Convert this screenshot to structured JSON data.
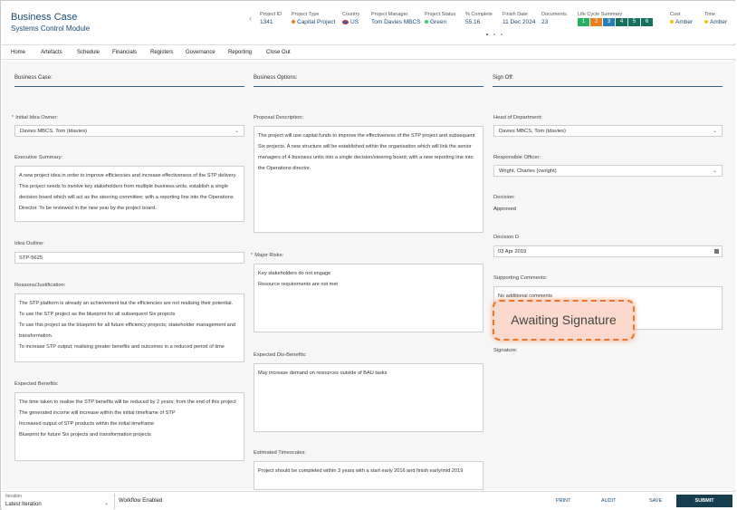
{
  "header": {
    "title": "Business Case",
    "subtitle": "Systems Control Module",
    "meta": [
      {
        "label": "Project ID",
        "value": "1341"
      },
      {
        "label": "Project Type",
        "value": "Capital Project",
        "dot_color": "#e67e22"
      },
      {
        "label": "Country",
        "value": "US"
      },
      {
        "label": "Project Manager",
        "value": "Tom Davies MBCS"
      },
      {
        "label": "Project Status",
        "value": "Green",
        "dot_color": "#2ecc71"
      },
      {
        "label": "% Complete",
        "value": "55.16"
      },
      {
        "label": "Finish Date",
        "value": "11 Dec 2024"
      },
      {
        "label": "Documents",
        "value": "23"
      },
      {
        "label": "Life Cycle Summary"
      },
      {
        "label": "Cost",
        "value": "Amber",
        "dot_color": "#f1c40f"
      },
      {
        "label": "Time",
        "value": "Amber",
        "dot_color": "#f1c40f"
      }
    ],
    "lifecycle": [
      {
        "n": "1",
        "color": "#27ae60"
      },
      {
        "n": "2",
        "color": "#e67e22"
      },
      {
        "n": "3",
        "color": "#2980b9"
      },
      {
        "n": "4",
        "color": "#16705f"
      },
      {
        "n": "5",
        "color": "#16705f"
      },
      {
        "n": "6",
        "color": "#16705f"
      }
    ]
  },
  "nav": [
    "Home",
    "Artefacts",
    "Schedule",
    "Financials",
    "Registers",
    "Governance",
    "Reporting",
    "Close Out"
  ],
  "sections": {
    "business_case": "Business Case:",
    "business_options": "Business Options:",
    "sign_off": "Sign Off:"
  },
  "left": {
    "idea_owner_label": "Initial Idea Owner:",
    "idea_owner_value": "Davies MBCS, Tom (tdavies)",
    "exec_summary_label": "Executive Summary:",
    "exec_summary": "A new project idea in order to improve efficiencies and increase effectiveness of the STP delivery. This project needs to involve key stakeholders from multiple business units. establish a single decision board which will act as the steering committee; with a reporting line into the Operations Director. To be reviewed in the new year by the project board.",
    "idea_outline_label": "Idea Outline:",
    "idea_outline_value": "STP-5625",
    "reasons_label": "Reasons/Justification:",
    "reasons": [
      "The STP platform is already an achievement but the efficiencies are not realising their potential.",
      "To use the STP project as the blueprint for all subsequent Six projects",
      "To use this project as the blueprint for all future efficiency projects; stakeholder management and transformation.",
      "To increase STP output; realising greater benefits and outcomes in a reduced period of time"
    ],
    "benefits_label": "Expected Benefits:",
    "benefits": [
      "The time taken to realise the STP benefits will be reduced by 2 years; from the end of this project",
      "The generated income will increase within the initial timeframe of STP",
      "Increased output of STP products within the initial timeframe",
      "Blueprint for future Six projects and transformation projects"
    ]
  },
  "middle": {
    "proposal_label": "Proposal Description:",
    "proposal": "The project will use capital funds to improve the effectiveness of the STP project and subsequent Six projects. A new structure will be established within the organisation which will link the senior managers of 4 business units into a single decision/steering board; with a new reporting line into the Operations director.",
    "risks_label": "Major Risks:",
    "risks": [
      "Key stakeholders do not engage",
      "Resource requirements are not met"
    ],
    "dis_benefits_label": "Expected Dis-Benefits:",
    "dis_benefits": "May increase demand on resources outside of BAU tasks",
    "timescales_label": "Estimated Timescales:",
    "timescales": "Project should be completed within 3 years with a start early 2016 and finish early/mid 2019"
  },
  "right": {
    "head_label": "Head of Department:",
    "head_value": "Davies MBCS, Tom (tdavies)",
    "officer_label": "Responsible Officer:",
    "officer_value": "Wright, Charles (cwright)",
    "decision_label": "Decision:",
    "decision_value": "Approved",
    "decision_date_label": "Decision D",
    "decision_date_value": "03 Apr 2019",
    "comments_label": "Supporting Comments:",
    "comments_value": "No additional comments",
    "signature_label": "Signature:",
    "signature_status": "Awaiting Signature"
  },
  "footer": {
    "iteration_label": "Iteration",
    "iteration_value": "Latest Iteration",
    "workflow": "Workflow Enabled",
    "print": "PRINT",
    "audit": "AUDIT",
    "save": "SAVE",
    "submit": "SUBMIT"
  }
}
